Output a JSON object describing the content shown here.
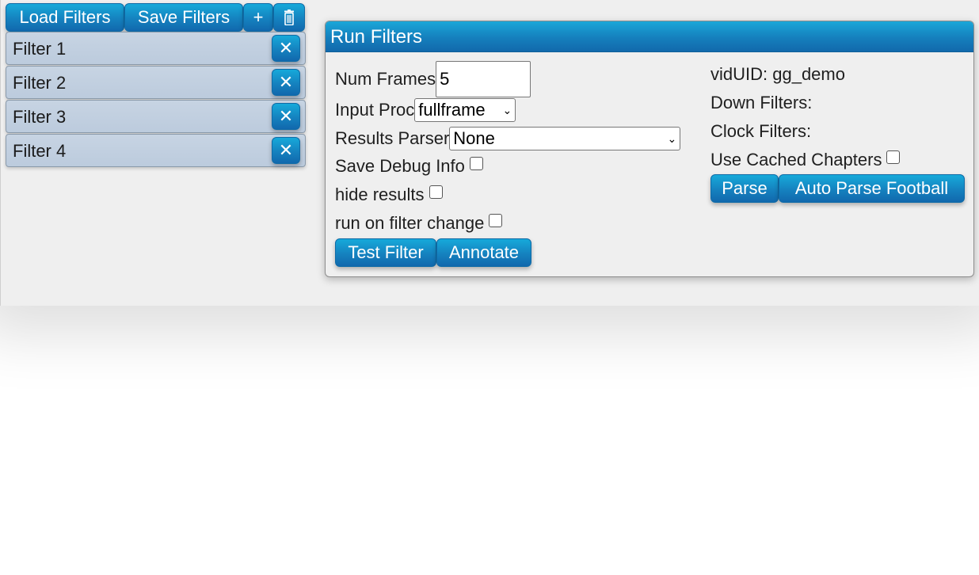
{
  "toolbar": {
    "load_label": "Load Filters",
    "save_label": "Save Filters",
    "add_label": "+",
    "trash_icon": "trash-icon"
  },
  "filters": [
    {
      "label": "Filter 1"
    },
    {
      "label": "Filter 2"
    },
    {
      "label": "Filter 3"
    },
    {
      "label": "Filter 4"
    }
  ],
  "close_glyph": "✕",
  "panel": {
    "title": "Run Filters",
    "num_frames_label": "Num Frames",
    "num_frames_value": "5",
    "input_proc_label": "Input Proc",
    "input_proc_value": "fullframe",
    "results_parser_label": "Results Parser",
    "results_parser_value": "None",
    "save_debug_label": "Save Debug Info",
    "hide_results_label": "hide results",
    "run_on_change_label": "run on filter change",
    "test_filter_label": "Test Filter",
    "annotate_label": "Annotate",
    "viduid_label": "vidUID: gg_demo",
    "down_filters_label": "Down Filters:",
    "clock_filters_label": "Clock Filters:",
    "use_cached_label": "Use Cached Chapters",
    "parse_label": "Parse",
    "auto_parse_label": "Auto Parse Football"
  },
  "colors": {
    "accent_blue": "#1582bf",
    "filter_bg": "#c3d0e0",
    "app_bg": "#efefef"
  }
}
